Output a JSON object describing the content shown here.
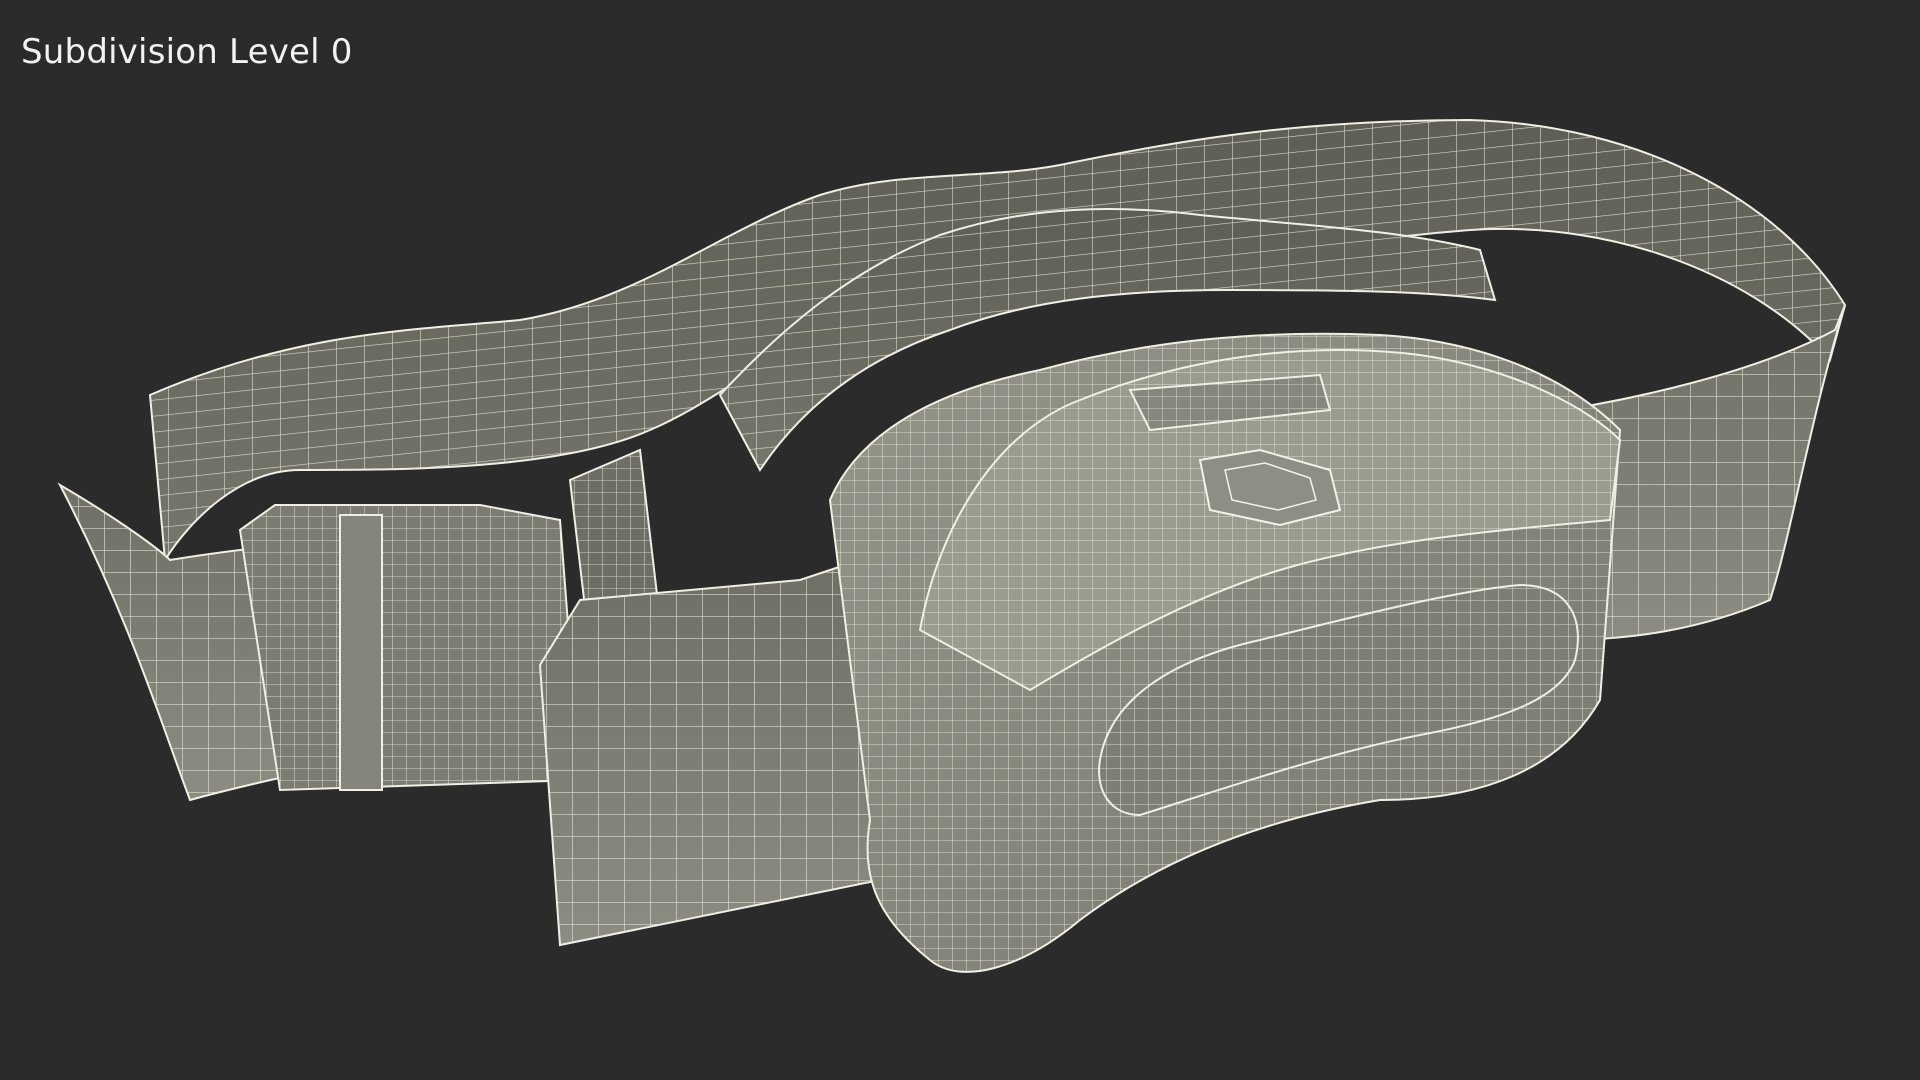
{
  "viewport": {
    "label": "Subdivision Level 0",
    "background_color": "#2b2b2b",
    "label_color": "#f2f2f2"
  },
  "model": {
    "subject": "belt-pouch-wireframe",
    "surface_color": "#8a8a7f",
    "wire_color": "#e8e8dc"
  }
}
